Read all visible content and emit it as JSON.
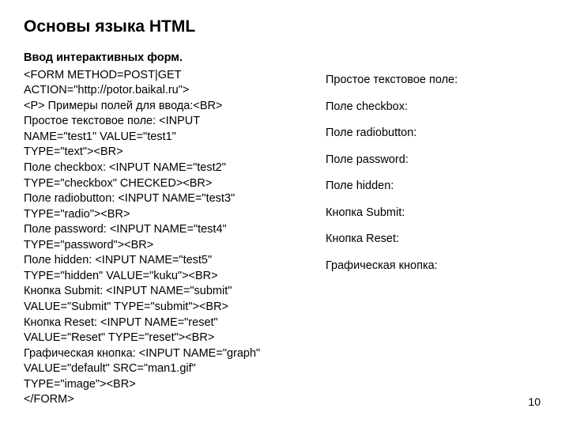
{
  "title": "Основы языка HTML",
  "left": {
    "subtitle": "Ввод интерактивных форм.",
    "line1": "<FORM METHOD=POST|GET",
    "line2": "ACTION=\"http://potor.baikal.ru\">",
    "line3": "<P> Примеры полей для ввода:<BR>",
    "line4": "Простое текстовое поле: <INPUT",
    "line5": "NAME=\"test1\" VALUE=\"test1\"",
    "line6": "TYPE=\"text\"><BR>",
    "line7": "Поле checkbox: <INPUT NAME=\"test2\"",
    "line8": "TYPE=\"checkbox\" CHECKED><BR>",
    "line9": "Поле radiobutton: <INPUT NAME=\"test3\"",
    "line10": "TYPE=\"radio\"><BR>",
    "line11": "Поле password: <INPUT NAME=\"test4\"",
    "line12": "TYPE=\"password\"><BR>",
    "line13": "Поле hidden: <INPUT NAME=\"test5\"",
    "line14": "TYPE=\"hidden\" VALUE=\"kuku\"><BR>",
    "line15": "Кнопка Submit: <INPUT NAME=\"submit\"",
    "line16": "VALUE=\"Submit\" TYPE=\"submit\"><BR>",
    "line17": "Кнопка Reset: <INPUT NAME=\"reset\"",
    "line18": "VALUE=\"Reset\" TYPE=\"reset\"><BR>",
    "line19": "Графическая кнопка: <INPUT NAME=\"graph\"",
    "line20": "VALUE=\"default\" SRC=\"man1.gif\"",
    "line21": "TYPE=\"image\"><BR>",
    "line22": "</FORM>"
  },
  "right": {
    "r1": "Простое текстовое поле:",
    "r2": "Поле checkbox:",
    "r3": "Поле radiobutton:",
    "r4": "Поле password:",
    "r5": "Поле hidden:",
    "r6": "Кнопка Submit:",
    "r7": "Кнопка Reset:",
    "r8": "Графическая кнопка:"
  },
  "page": "10"
}
